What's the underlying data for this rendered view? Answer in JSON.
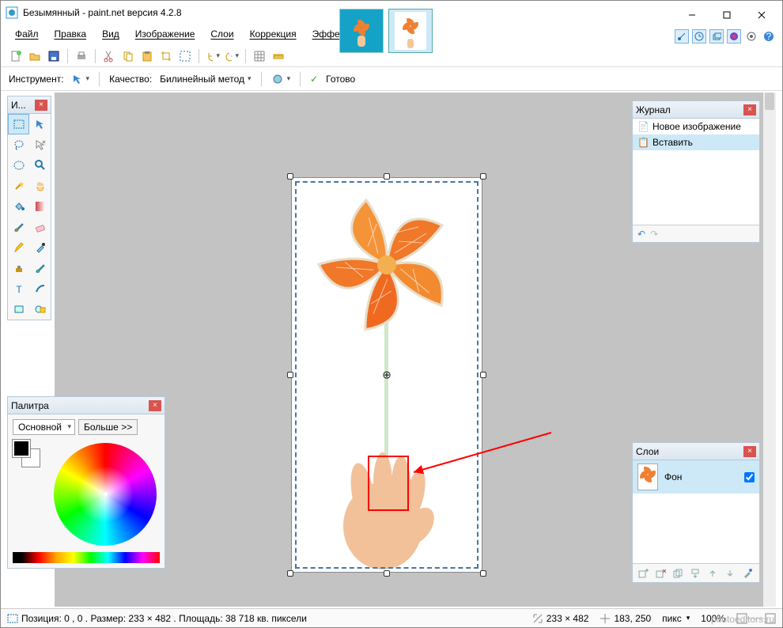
{
  "title": "Безымянный - paint.net версия 4.2.8",
  "menu": {
    "file": "Файл",
    "edit": "Правка",
    "view": "Вид",
    "image": "Изображение",
    "layers": "Слои",
    "correction": "Коррекция",
    "effects": "Эффекты"
  },
  "options": {
    "tool_label": "Инструмент:",
    "quality_label": "Качество:",
    "quality_value": "Билинейный метод",
    "status_ready": "Готово"
  },
  "toolbox": {
    "title": "И..."
  },
  "palette": {
    "title": "Палитра",
    "primary": "Основной",
    "more": "Больше >>"
  },
  "history": {
    "title": "Журнал",
    "items": [
      "Новое изображение",
      "Вставить"
    ]
  },
  "layers": {
    "title": "Слои",
    "bg": "Фон"
  },
  "status": {
    "pos": "Позиция: 0 , 0 . Размер: 233  × 482 . Площадь: 38 718 кв. пиксели",
    "dims": "233 × 482",
    "cursor": "183, 250",
    "unit": "пикс",
    "zoom": "100%"
  },
  "watermark": "photoeditors.ru"
}
